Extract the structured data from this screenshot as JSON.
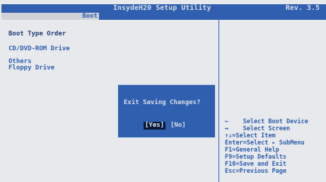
{
  "header": {
    "title": "InsydeH20 Setup Utility",
    "revision": "Rev. 3.5"
  },
  "tabs": [
    {
      "label": "Boot"
    }
  ],
  "main": {
    "section_title": "Boot Type Order",
    "boot_order": [
      "CD/DVD-ROM Drive",
      "Hard Disk Drive",
      "Others",
      "Floppy Drive"
    ],
    "selected_index": 1
  },
  "dialog": {
    "question": "Exit Saving Changes?",
    "yes_label": "[Yes]",
    "no_label": "[No]"
  },
  "help": [
    "←    Select Boot Device",
    "↔    Select Screen",
    "↑↓=Select Item",
    "Enter=Select ▸ SubMenu",
    "F1=General Help",
    "F9=Setup Defaults",
    "F10=Save and Exit",
    "Esc=Previous Page"
  ],
  "colors": {
    "accent": "#2f5fae",
    "background": "#e7e9ec",
    "dialog_bg": "#2f5fae",
    "selected_text": "#ffffff"
  }
}
